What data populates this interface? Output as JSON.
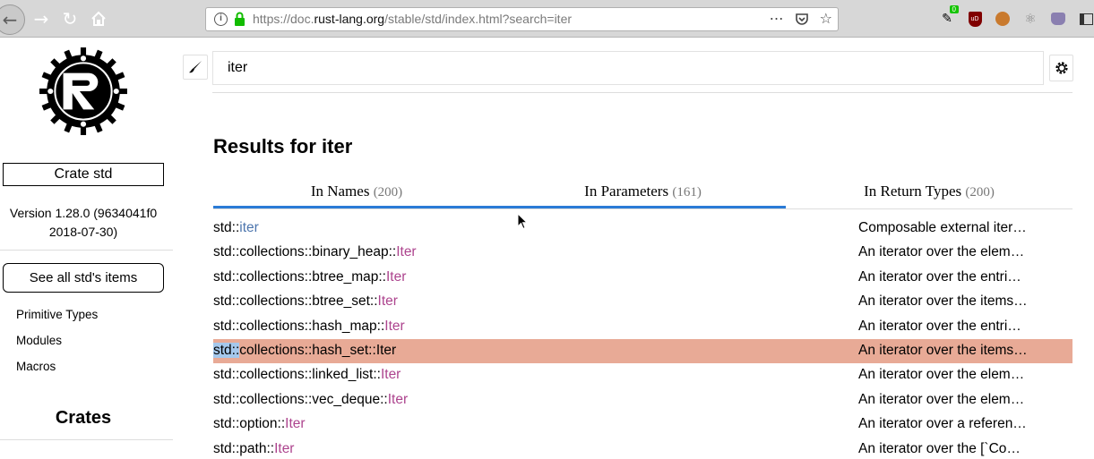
{
  "browser": {
    "url_prefix": "https://doc.",
    "url_host": "rust-lang.org",
    "url_path": "/stable/std/index.html?search=iter",
    "ext_badge": "0",
    "ext_ublock": "uD"
  },
  "sidebar": {
    "crate_label": "Crate std",
    "version_line1": "Version 1.28.0 (9634041f0",
    "version_line2": "2018-07-30)",
    "see_all_label": "See all std's items",
    "items": [
      "Primitive Types",
      "Modules",
      "Macros"
    ],
    "crates_heading": "Crates"
  },
  "search": {
    "value": "iter",
    "results_title": "Results for iter"
  },
  "tabs": [
    {
      "label": "In Names",
      "count": "(200)"
    },
    {
      "label": "In Parameters",
      "count": "(161)"
    },
    {
      "label": "In Return Types",
      "count": "(200)"
    }
  ],
  "results": [
    {
      "prefix": "std::",
      "name": "iter",
      "kind": "mod",
      "desc": "Composable external iter…"
    },
    {
      "prefix": "std::collections::binary_heap::",
      "name": "Iter",
      "kind": "struct",
      "desc": "An iterator over the elem…"
    },
    {
      "prefix": "std::collections::btree_map::",
      "name": "Iter",
      "kind": "struct",
      "desc": "An iterator over the entri…"
    },
    {
      "prefix": "std::collections::btree_set::",
      "name": "Iter",
      "kind": "struct",
      "desc": "An iterator over the items…"
    },
    {
      "prefix": "std::collections::hash_map::",
      "name": "Iter",
      "kind": "struct",
      "desc": "An iterator over the entri…"
    },
    {
      "prefix_hl": "std::",
      "prefix": "collections::hash_set::",
      "name": "Iter",
      "kind": "struct",
      "desc": "An iterator over the items…",
      "selected": true
    },
    {
      "prefix": "std::collections::linked_list::",
      "name": "Iter",
      "kind": "struct",
      "desc": "An iterator over the elem…"
    },
    {
      "prefix": "std::collections::vec_deque::",
      "name": "Iter",
      "kind": "struct",
      "desc": "An iterator over the elem…"
    },
    {
      "prefix": "std::option::",
      "name": "Iter",
      "kind": "struct",
      "desc": "An iterator over a referen…"
    },
    {
      "prefix": "std::path::",
      "name": "Iter",
      "kind": "struct",
      "desc": "An iterator over the [`Co…"
    }
  ],
  "colors": {
    "struct": "#ad448e",
    "module": "#4d76ae",
    "selected_row": "#e8aa96",
    "tab_underline": "#2a7bd6"
  }
}
